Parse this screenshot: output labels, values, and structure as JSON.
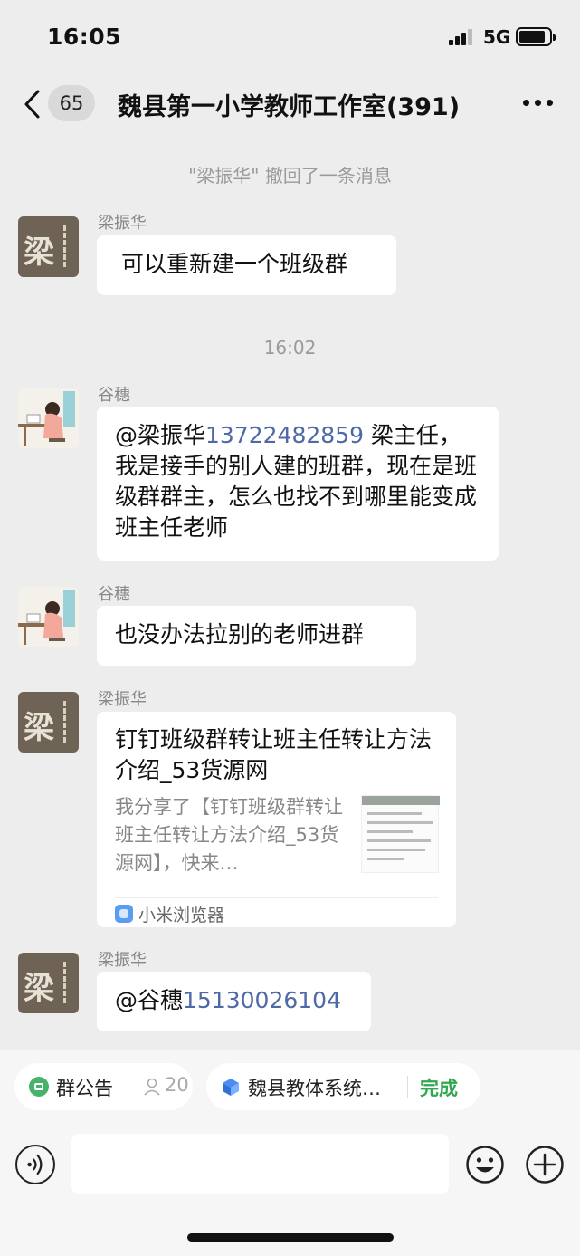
{
  "status_bar": {
    "time": "16:05",
    "network": "5G"
  },
  "header": {
    "unread_count": "65",
    "title": "魏县第一小学教师工作室(391)"
  },
  "chat": {
    "system_message": "\"梁振华\" 撤回了一条消息",
    "time_divider": "16:02",
    "messages": [
      {
        "sender": "梁振华",
        "text": "可以重新建一个班级群"
      },
      {
        "sender": "谷穗",
        "mention": "@梁振华",
        "phone": "13722482859",
        "text": " 梁主任，我是接手的别人建的班群，现在是班级群群主，怎么也找不到哪里能变成班主任老师"
      },
      {
        "sender": "谷穗",
        "text": "也没办法拉别的老师进群"
      },
      {
        "sender": "梁振华",
        "link_title": "钉钉班级群转让班主任转让方法介绍_53货源网",
        "link_desc": "我分享了【钉钉班级群转让班主任转让方法介绍_53货源网】，快来…",
        "link_source": "小米浏览器"
      },
      {
        "sender": "梁振华",
        "mention": "@谷穗",
        "phone": "15130026104"
      }
    ]
  },
  "bottom": {
    "notice_label": "群公告",
    "notice_count": "20",
    "app_label": "魏县教体系统…",
    "done_label": "完成"
  },
  "avatar_seal_char": "梁",
  "icons": {
    "back": "back-chevron-icon",
    "more": "more-dots-icon",
    "voice": "voice-icon",
    "emoji": "emoji-icon",
    "plus": "plus-icon"
  }
}
